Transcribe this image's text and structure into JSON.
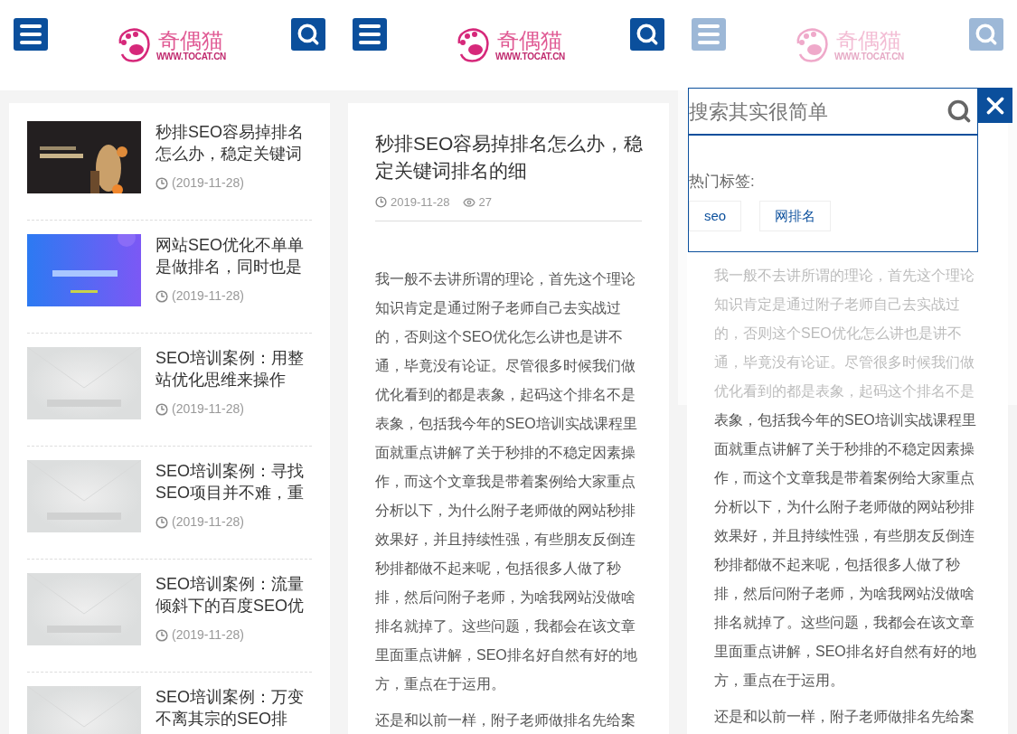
{
  "screens": [
    {
      "kind": "list",
      "header": {
        "logo_name": "奇偶猫",
        "logo_url": "WWW.TOCAT.CN"
      },
      "posts": [
        {
          "title": "秒排SEO容易掉排名怎么办，稳定关键词",
          "date": "(2019-11-28)"
        },
        {
          "title": "网站SEO优化不单单是做排名，同时也是",
          "date": "(2019-11-28)"
        },
        {
          "title": "SEO培训案例：用整站优化思维来操作",
          "date": "(2019-11-28)"
        },
        {
          "title": "SEO培训案例：寻找SEO项目并不难，重",
          "date": "(2019-11-28)"
        },
        {
          "title": "SEO培训案例：流量倾斜下的百度SEO优",
          "date": "(2019-11-28)"
        },
        {
          "title": "SEO培训案例：万变不离其宗的SEO排"
        }
      ]
    },
    {
      "kind": "article",
      "header": {
        "logo_name": "奇偶猫",
        "logo_url": "WWW.TOCAT.CN"
      },
      "title": "秒排SEO容易掉排名怎么办，稳定关键词排名的细",
      "date": "2019-11-28",
      "views": "27",
      "paragraphs": [
        "我一般不去讲所谓的理论，首先这个理论知识肯定是通过附子老师自己去实战过的，否则这个SEO优化怎么讲也是讲不通，毕竟没有论证。尽管很多时候我们做优化看到的都是表象，起码这个排名不是表象，包括我今年的SEO培训实战课程里面就重点讲解了关于秒排的不稳定因素操作，而这个文章我是带着案例给大家重点分析以下，为什么附子老师做的网站秒排效果好，并且持续性强，有些朋友反倒连秒排都做不起来呢，包括很多人做了秒排，然后问附子老师，为啥我网站没做啥排名就掉了。这些问题，我都会在该文章里面重点讲解，SEO排名好自然有好的地方，重点在于运用。",
        "还是和以前一样，附子老师做排名先给案"
      ]
    },
    {
      "kind": "search",
      "header": {
        "logo_name": "奇偶猫",
        "logo_url": "WWW.TOCAT.CN"
      },
      "search": {
        "placeholder": "搜索其实很简单",
        "tags_label": "热门标签:",
        "tags": [
          "seo",
          "网排名"
        ]
      },
      "paragraphs": [
        "我一般不去讲所谓的理论，首先这个理论知识肯定是通过附子老师自己去实战过的，否则这个SEO优化怎么讲也是讲不通，毕竟没有论证。尽管很多时候我们做优化看到的都是表象，起码这个排名不是表象，包括我今年的SEO培训实战课程里面就重点讲解了关于秒排的不稳定因素操作，而这个文章我是带着案例给大家重点分析以下，为什么附子老师做的网站秒排效果好，并且持续性强，有些朋友反倒连秒排都做不起来呢，包括很多人做了秒排，然后问附子老师，为啥我网站没做啥排名就掉了。这些问题，我都会在该文章里面重点讲解，SEO排名好自然有好的地方，重点在于运用。",
        "还是和以前一样，附子老师做排名先给案"
      ]
    }
  ]
}
